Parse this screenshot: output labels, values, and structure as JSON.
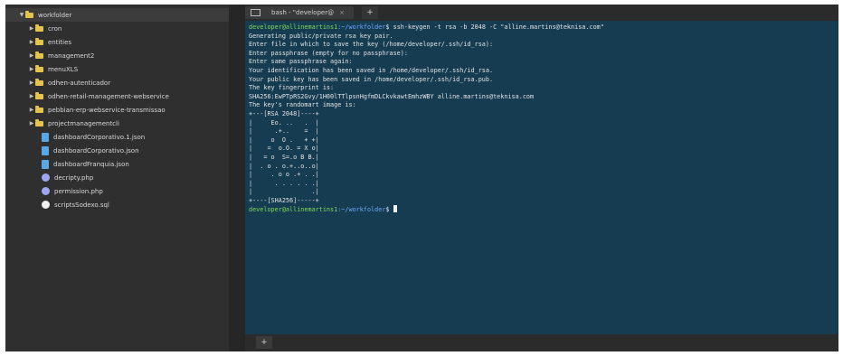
{
  "sidebar": {
    "root": {
      "label": "workfolder",
      "icon": "folder-icon"
    },
    "items": [
      {
        "label": "cron",
        "type": "folder"
      },
      {
        "label": "entities",
        "type": "folder"
      },
      {
        "label": "management2",
        "type": "folder"
      },
      {
        "label": "menuXLS",
        "type": "folder"
      },
      {
        "label": "odhen-autenticador",
        "type": "folder"
      },
      {
        "label": "odhen-retail-management-webservice",
        "type": "folder"
      },
      {
        "label": "pebbian-erp-webservice-transmissao",
        "type": "folder"
      },
      {
        "label": "projectmanagementcli",
        "type": "folder"
      },
      {
        "label": "dashboardCorporativo.1.json",
        "type": "json"
      },
      {
        "label": "dashboardCorporativo.json",
        "type": "json"
      },
      {
        "label": "dashboardFranquia.json",
        "type": "json"
      },
      {
        "label": "decripty.php",
        "type": "php"
      },
      {
        "label": "permission.php",
        "type": "php"
      },
      {
        "label": "scriptsSodexo.sql",
        "type": "sql"
      }
    ]
  },
  "tabs": {
    "active_label": "bash - \"developer@",
    "close_label": "×",
    "new_label": "+"
  },
  "terminal": {
    "prompt_user": "developer@allinemartins1",
    "prompt_path": ":~/workfolder",
    "command": "$ ssh-keygen -t rsa -b 2048 -C \"alline.martins@teknisa.com\"",
    "output": [
      "Generating public/private rsa key pair.",
      "Enter file in which to save the key (/home/developer/.ssh/id_rsa):",
      "Enter passphrase (empty for no passphrase):",
      "Enter same passphrase again:",
      "Your identification has been saved in /home/developer/.ssh/id_rsa.",
      "Your public key has been saved in /home/developer/.ssh/id_rsa.pub.",
      "The key fingerprint is:",
      "SHA256:EwPTpRS2Gvy/1H00lTTlpsnHgfmDLCkvkawtEmhzWBY alline.martins@teknisa.com",
      "The key's randomart image is:",
      "+---[RSA 2048]----+",
      "|     Eo. ..   .  |",
      "|      .+..    =  |",
      "|     o  O .   + +|",
      "|    =  o.O. = X o|",
      "|   = o  S=.o B B.|",
      "|  . o . o.+..o..o|",
      "|     . o o .+ . .|",
      "|      . . . . . .|",
      "|                .|",
      "+----[SHA256]-----+"
    ],
    "final_prompt_end": "$ "
  },
  "bottombar": {
    "add_label": "+"
  }
}
